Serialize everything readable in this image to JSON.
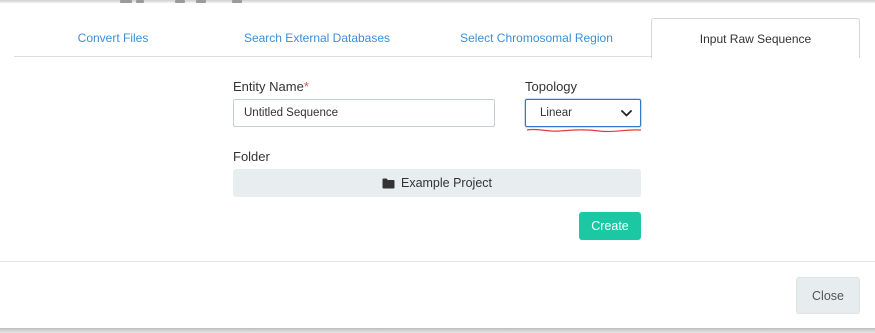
{
  "tabs": [
    {
      "label": "Convert Files",
      "active": false
    },
    {
      "label": "Search External Databases",
      "active": false
    },
    {
      "label": "Select Chromosomal Region",
      "active": false
    },
    {
      "label": "Input Raw Sequence",
      "active": true
    }
  ],
  "form": {
    "entity_name_label": "Entity Name",
    "required_marker": "*",
    "entity_name_value": "Untitled Sequence",
    "topology_label": "Topology",
    "topology_value": "Linear",
    "folder_label": "Folder",
    "folder_value": "Example Project",
    "folder_icon": "folder-icon",
    "create_label": "Create"
  },
  "footer": {
    "close_label": "Close"
  },
  "colors": {
    "tab_link": "#3d8fd9",
    "create_button": "#1cc7a4",
    "annotation_underline": "#e23b3b",
    "required_marker": "#d9534f"
  }
}
